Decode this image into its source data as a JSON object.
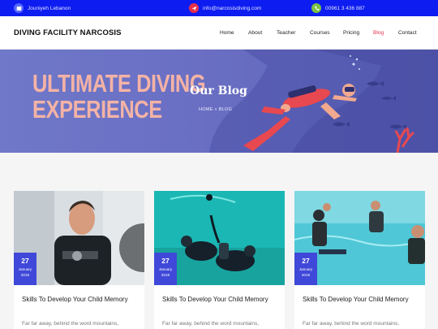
{
  "topbar": {
    "location": "Jouniyeh Lebanon",
    "email": "info@narcosisdiving.com",
    "phone": "00961 3 436 887"
  },
  "nav": {
    "brand": "DIVING FACILITY NARCOSIS",
    "items": [
      {
        "label": "Home"
      },
      {
        "label": "About"
      },
      {
        "label": "Teacher"
      },
      {
        "label": "Courses"
      },
      {
        "label": "Pricing"
      },
      {
        "label": "Blog",
        "active": true
      },
      {
        "label": "Contact"
      }
    ],
    "active_color": "#e8304b"
  },
  "hero": {
    "line1": "ULTIMATE DIVING",
    "line2": "EXPERIENCE",
    "title": "Our Blog",
    "breadcrumb": "HOME » BLOG"
  },
  "posts": [
    {
      "day": "27",
      "month": "January",
      "year": "2019",
      "title": "Skills To Develop Your Child Memory",
      "excerpt": "Far far away, behind the word mountains,"
    },
    {
      "day": "27",
      "month": "January",
      "year": "2019",
      "title": "Skills To Develop Your Child Memory",
      "excerpt": "Far far away, behind the word mountains,"
    },
    {
      "day": "27",
      "month": "January",
      "year": "2019",
      "title": "Skills To Develop Your Child Memory",
      "excerpt": "Far far away, behind the word mountains,"
    }
  ],
  "colors": {
    "topbar": "#0d1cf0",
    "accent": "#3f48d8",
    "hero_text": "#f4b3a6"
  },
  "icons": {
    "location": "map-icon",
    "email": "paper-plane-icon",
    "phone": "phone-icon"
  }
}
